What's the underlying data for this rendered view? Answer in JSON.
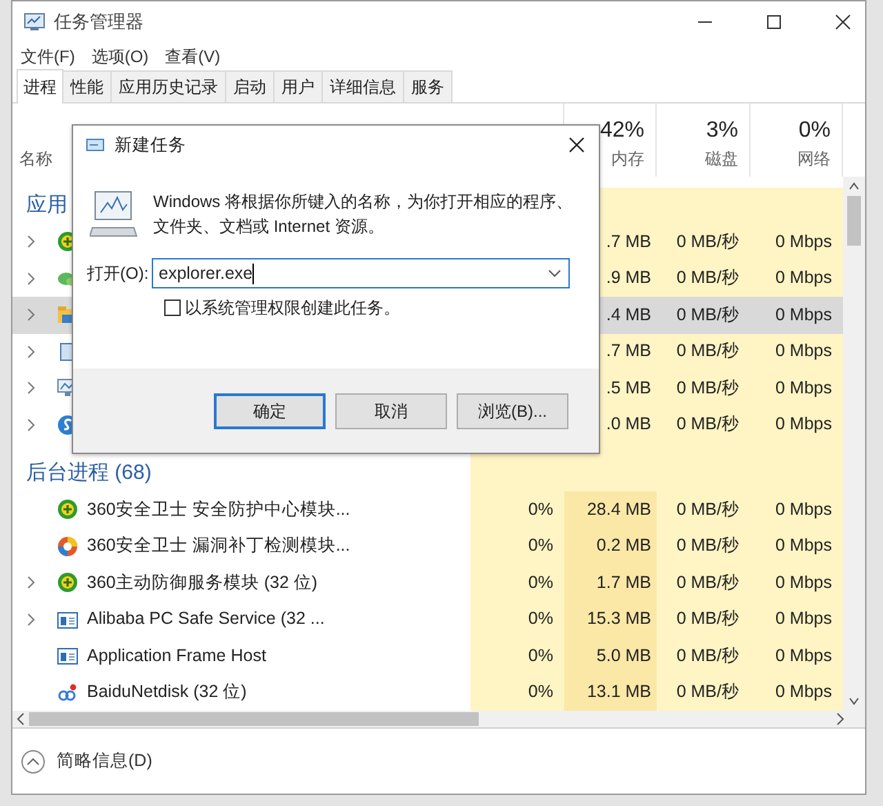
{
  "window": {
    "title": "任务管理器"
  },
  "menu": [
    "文件(F)",
    "选项(O)",
    "查看(V)"
  ],
  "tabs": [
    {
      "label": "进程",
      "selected": true
    },
    {
      "label": "性能",
      "selected": false
    },
    {
      "label": "应用历史记录",
      "selected": false
    },
    {
      "label": "启动",
      "selected": false
    },
    {
      "label": "用户",
      "selected": false
    },
    {
      "label": "详细信息",
      "selected": false
    },
    {
      "label": "服务",
      "selected": false
    }
  ],
  "name_header": "名称",
  "columns": [
    {
      "percent": "42%",
      "label": "内存"
    },
    {
      "percent": "3%",
      "label": "磁盘"
    },
    {
      "percent": "0%",
      "label": "网络"
    }
  ],
  "groups": [
    {
      "title": "应用",
      "rows": [
        {
          "expandable": true,
          "selected": false,
          "memory": ".7 MB",
          "disk": "0 MB/秒",
          "network": "0 Mbps"
        },
        {
          "expandable": true,
          "selected": false,
          "memory": ".9 MB",
          "disk": "0 MB/秒",
          "network": "0 Mbps"
        },
        {
          "expandable": true,
          "selected": true,
          "memory": ".4 MB",
          "disk": "0 MB/秒",
          "network": "0 Mbps"
        },
        {
          "expandable": true,
          "selected": false,
          "memory": ".7 MB",
          "disk": "0 MB/秒",
          "network": "0 Mbps"
        },
        {
          "expandable": true,
          "selected": false,
          "memory": ".5 MB",
          "disk": "0 MB/秒",
          "network": "0 Mbps"
        },
        {
          "expandable": true,
          "selected": false,
          "memory": ".0 MB",
          "disk": "0 MB/秒",
          "network": "0 Mbps"
        }
      ]
    },
    {
      "title": "后台进程 (68)",
      "rows": [
        {
          "expandable": false,
          "selected": false,
          "name": "360安全卫士 安全防护中心模块...",
          "cpu": "0%",
          "memory": "28.4 MB",
          "disk": "0 MB/秒",
          "network": "0 Mbps"
        },
        {
          "expandable": false,
          "selected": false,
          "name": "360安全卫士 漏洞补丁检测模块...",
          "cpu": "0%",
          "memory": "0.2 MB",
          "disk": "0 MB/秒",
          "network": "0 Mbps"
        },
        {
          "expandable": true,
          "selected": false,
          "name": "360主动防御服务模块 (32 位)",
          "cpu": "0%",
          "memory": "1.7 MB",
          "disk": "0 MB/秒",
          "network": "0 Mbps"
        },
        {
          "expandable": true,
          "selected": false,
          "name": "Alibaba PC Safe Service (32 ...",
          "cpu": "0%",
          "memory": "15.3 MB",
          "disk": "0 MB/秒",
          "network": "0 Mbps"
        },
        {
          "expandable": false,
          "selected": false,
          "name": "Application Frame Host",
          "cpu": "0%",
          "memory": "5.0 MB",
          "disk": "0 MB/秒",
          "network": "0 Mbps"
        },
        {
          "expandable": false,
          "selected": false,
          "name": "BaiduNetdisk (32 位)",
          "cpu": "0%",
          "memory": "13.1 MB",
          "disk": "0 MB/秒",
          "network": "0 Mbps"
        }
      ]
    }
  ],
  "footer": "简略信息(D)",
  "dialog": {
    "title": "新建任务",
    "description": "Windows 将根据你所键入的名称，为你打开相应的程序、文件夹、文档或 Internet 资源。",
    "open_label": "打开(O):",
    "open_value": "explorer.exe",
    "admin_checkbox": {
      "label": "以系统管理权限创建此任务。",
      "checked": false
    },
    "buttons": [
      {
        "label": "确定",
        "default": true
      },
      {
        "label": "取消",
        "default": false
      },
      {
        "label": "浏览(B)...",
        "default": false
      }
    ]
  }
}
